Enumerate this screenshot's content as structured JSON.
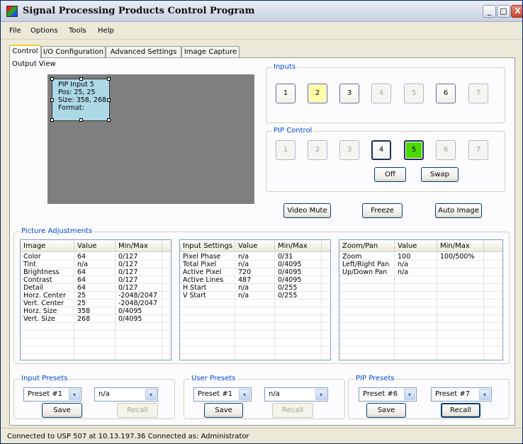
{
  "window": {
    "title": "Signal Processing Products Control Program",
    "controls": [
      "_",
      "□",
      "X"
    ]
  },
  "menu": [
    "File",
    "Options",
    "Tools",
    "Help"
  ],
  "tabs": [
    "Control",
    "I/O Configuration",
    "Advanced Settings",
    "Image Capture"
  ],
  "output_view": {
    "label": "Output View",
    "pip_lines": [
      "PIP Input 5",
      "Pos: 25, 25",
      "Size: 358, 268",
      "Format:"
    ]
  },
  "inputs": {
    "label": "Inputs",
    "buttons": [
      "1",
      "2",
      "3",
      "4",
      "5",
      "6",
      "7"
    ]
  },
  "pip_control": {
    "label": "PIP Control",
    "buttons": [
      "1",
      "2",
      "3",
      "4",
      "5",
      "6",
      "7"
    ],
    "off": "Off",
    "swap": "Swap"
  },
  "actions": {
    "video_mute": "Video Mute",
    "freeze": "Freeze",
    "auto_image": "Auto Image"
  },
  "picture_adjustments": {
    "label": "Picture Adjustments",
    "image_table": {
      "headers": [
        "Image",
        "Value",
        "Min/Max"
      ],
      "rows": [
        [
          "Color",
          "64",
          "0/127"
        ],
        [
          "Tint",
          "n/a",
          "0/127"
        ],
        [
          "Brightness",
          "64",
          "0/127"
        ],
        [
          "Contrast",
          "64",
          "0/127"
        ],
        [
          "Detail",
          "64",
          "0/127"
        ],
        [
          "Horz. Center",
          "25",
          "-2048/2047"
        ],
        [
          "Vert. Center",
          "25",
          "-2048/2047"
        ],
        [
          "Horz. Size",
          "358",
          "0/4095"
        ],
        [
          "Vert. Size",
          "268",
          "0/4095"
        ]
      ]
    },
    "input_table": {
      "headers": [
        "Input Settings",
        "Value",
        "Min/Max"
      ],
      "rows": [
        [
          "Pixel Phase",
          "n/a",
          "0/31"
        ],
        [
          "Total Pixel",
          "n/a",
          "0/4095"
        ],
        [
          "Active Pixel",
          "720",
          "0/4095"
        ],
        [
          "Active Lines",
          "487",
          "0/4095"
        ],
        [
          "H Start",
          "n/a",
          "0/255"
        ],
        [
          "V Start",
          "n/a",
          "0/255"
        ]
      ]
    },
    "zoom_table": {
      "headers": [
        "Zoom/Pan",
        "Value",
        "Min/Max"
      ],
      "rows": [
        [
          "Zoom",
          "100",
          "100/500%"
        ],
        [
          "Left/Right Pan",
          "n/a",
          ""
        ],
        [
          "Up/Down Pan",
          "n/a",
          ""
        ]
      ]
    }
  },
  "presets": {
    "input": {
      "label": "Input Presets",
      "combo1": "Preset #1",
      "combo2": "n/a",
      "save": "Save",
      "recall": "Recall"
    },
    "user": {
      "label": "User Presets",
      "combo1": "Preset #1",
      "combo2": "n/a",
      "save": "Save",
      "recall": "Recall"
    },
    "pip": {
      "label": "PIP Presets",
      "combo1": "Preset #6",
      "combo2": "Preset #7",
      "save": "Save",
      "recall": "Recall"
    }
  },
  "colors": {
    "selected_input": "#ffffa8",
    "active_pip": "#4cd800",
    "group_label": "#0046d5"
  },
  "icons": {
    "dropdown": "▾"
  },
  "status": "Connected to USP 507 at 10.13.197.36   Connected as: Administrator"
}
